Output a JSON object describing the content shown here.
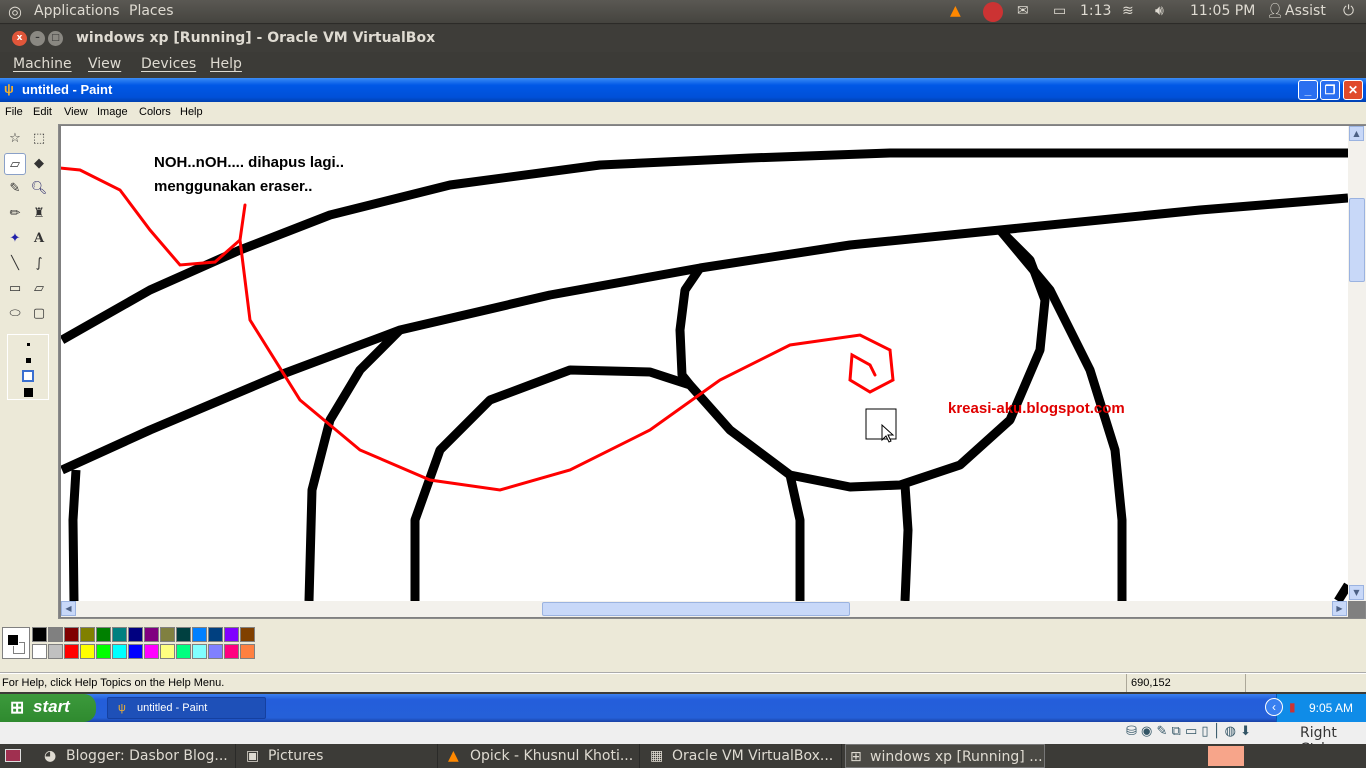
{
  "ubuntu_top": {
    "applications": "Applications",
    "places": "Places",
    "battery_time": "1:13",
    "clock": "11:05 PM",
    "user": "Assist"
  },
  "virtualbox": {
    "title": "windows xp [Running] - Oracle VM VirtualBox",
    "menu": [
      "Machine",
      "View",
      "Devices",
      "Help"
    ],
    "host_key": "Right Ctrl"
  },
  "paint": {
    "title": "untitled - Paint",
    "menu": [
      "File",
      "Edit",
      "View",
      "Image",
      "Colors",
      "Help"
    ],
    "canvas_text": {
      "line1": "NOH..nOH.... dihapus lagi..",
      "line2": "menggunakan eraser..",
      "watermark": "kreasi-aku.blogspot.com"
    },
    "selected_tool": "eraser",
    "palette": [
      "#000000",
      "#808080",
      "#800000",
      "#808000",
      "#008000",
      "#008080",
      "#000080",
      "#800080",
      "#808040",
      "#004040",
      "#0080ff",
      "#004080",
      "#8000ff",
      "#804000",
      "#ffffff",
      "#c0c0c0",
      "#ff0000",
      "#ffff00",
      "#00ff00",
      "#00ffff",
      "#0000ff",
      "#ff00ff",
      "#ffff80",
      "#00ff80",
      "#80ffff",
      "#8080ff",
      "#ff0080",
      "#ff8040"
    ],
    "foreground": "#000000",
    "background": "#ffffff",
    "status_help": "For Help, click Help Topics on the Help Menu.",
    "coords": "690,152"
  },
  "xp_taskbar": {
    "start": "start",
    "task": "untitled - Paint",
    "clock": "9:05 AM"
  },
  "ubuntu_bottom": {
    "tasks": [
      "Blogger: Dasbor Blog...",
      "Pictures",
      "Opick - Khusnul Khoti...",
      "Oracle VM VirtualBox...",
      "windows xp [Running] ..."
    ]
  }
}
